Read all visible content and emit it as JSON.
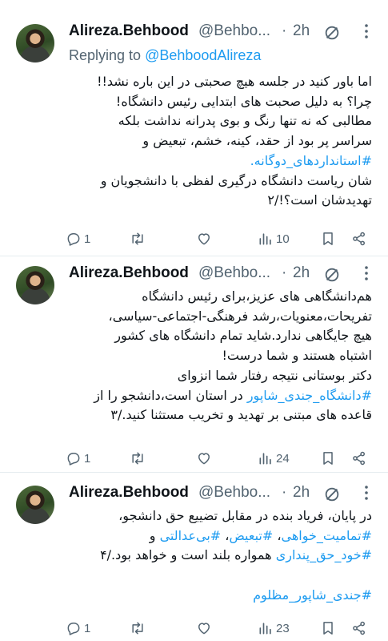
{
  "colors": {
    "accent": "#1d9bf0",
    "secondary": "#536471",
    "text": "#0f1419",
    "divider": "#e6ecf0"
  },
  "tweets": [
    {
      "author": {
        "name": "Alireza.Behbood",
        "handle": "@Behbo...",
        "dot": "·",
        "time": "2h"
      },
      "replying": {
        "prefix": "Replying to",
        "target": "@BehboodAlireza"
      },
      "lines": [
        "اما باور کنید در جلسه هیچ صحبتی در این باره نشد!!",
        "چرا؟ به دلیل صحبت های ابتدایی رئیس دانشگاه!",
        "مطالبی که نه تنها رنگ و بوی پدرانه نداشت بلکه",
        "سراسر پر بود از حقد، کینه، خشم، تبعیض و",
        "#استانداردهای_دوگانه.",
        "شان ریاست دانشگاه درگیری لفظی با دانشجویان و",
        "تهدیدشان است؟!/۲"
      ],
      "stats": {
        "replies": "1",
        "retweets": "",
        "likes": "",
        "views": "10"
      }
    },
    {
      "author": {
        "name": "Alireza.Behbood",
        "handle": "@Behbo...",
        "dot": "·",
        "time": "2h"
      },
      "lines": [
        "هم‌دانشگاهی های عزیز،برای رئیس دانشگاه",
        "تفریحات،معنویات،رشد فرهنگی-اجتماعی-سیاسی،",
        "هیچ جایگاهی ندارد.شاید تمام دانشگاه های کشور",
        "اشتباه هستند و شما درست!",
        "دکتر بوستانی نتیجه رفتار شما انزوای",
        "#دانشگاه_جندی_شاپور در استان است،دانشجو را از",
        "قاعده های مبتنی بر تهدید و تخریب مستثنا کنید./۳"
      ],
      "stats": {
        "replies": "1",
        "retweets": "",
        "likes": "",
        "views": "24"
      }
    },
    {
      "author": {
        "name": "Alireza.Behbood",
        "handle": "@Behbo...",
        "dot": "·",
        "time": "2h"
      },
      "lines": [
        "در پایان، فریاد بنده در مقابل تضییع حق دانشجو،",
        "#تمامیت_خواهی، #تبعیض، #بی‌عدالتی و",
        "#خود_حق_پنداری همواره بلند است و خواهد بود./۴",
        "",
        "#جندی_شاپور_مظلوم"
      ],
      "stats": {
        "replies": "1",
        "retweets": "",
        "likes": "",
        "views": "23"
      }
    }
  ],
  "icons": [
    "reply-icon",
    "retweet-icon",
    "like-icon",
    "views-icon",
    "bookmark-icon",
    "share-icon",
    "grok-icon",
    "more-icon"
  ]
}
